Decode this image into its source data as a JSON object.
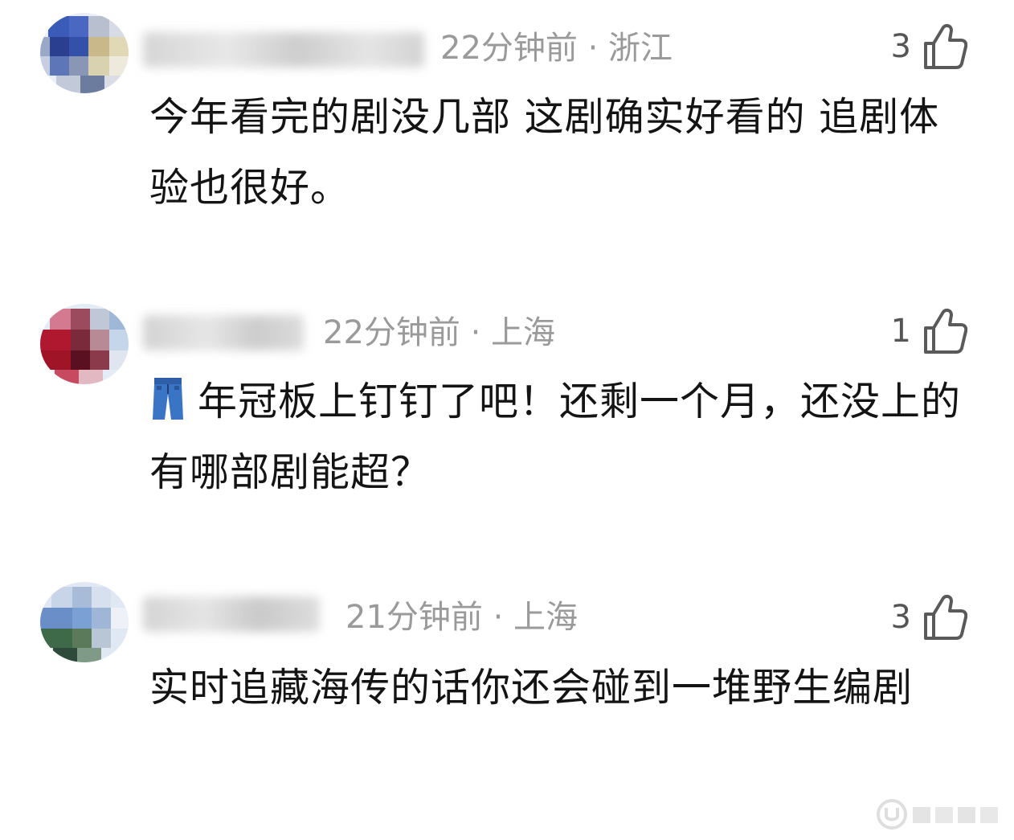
{
  "comments": [
    {
      "time_location": "22分钟前 · 浙江",
      "likes": "3",
      "text": "今年看完的剧没几部 这剧确实好看的 追剧体验也很好。",
      "avatar_colors": [
        "#3b5bb8",
        "#9aa8c8",
        "#c9b98a",
        "#2a3f8f",
        "#e1d9b5",
        "#6c7c9e"
      ]
    },
    {
      "time_location": "22分钟前 · 上海",
      "likes": "1",
      "emoji": "jeans-icon",
      "text": "年冠板上钉钉了吧！还剩一个月，还没上的有哪部剧能超？",
      "avatar_colors": [
        "#b01830",
        "#7a2a3a",
        "#d47a90",
        "#c0c8d8",
        "#5a1020",
        "#a0b8d8"
      ]
    },
    {
      "time_location": "21分钟前 · 上海",
      "likes": "3",
      "text": "实时追藏海传的话你还会碰到一堆野生编剧",
      "avatar_colors": [
        "#6a8fc8",
        "#3e6a4a",
        "#c8d4e8",
        "#5a7a5a",
        "#a8bcd8",
        "#2e4a3a"
      ]
    }
  ],
  "watermark": {
    "icon": "weibo-logo-icon"
  },
  "colors": {
    "meta_text": "#9a9a9a",
    "body_text": "#141414",
    "like_icon": "#5a5a5a"
  }
}
